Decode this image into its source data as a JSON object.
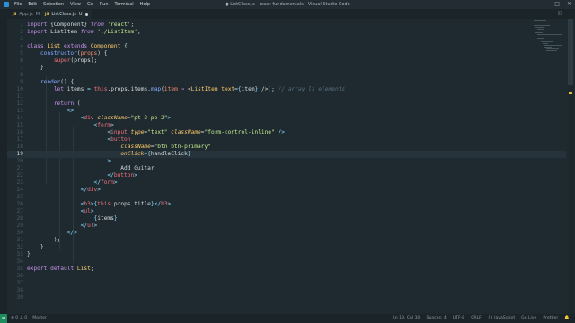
{
  "window": {
    "title": "● ListClass.js - react-fundamentals - Visual Studio Code",
    "menu": [
      "File",
      "Edit",
      "Selection",
      "View",
      "Go",
      "Run",
      "Terminal",
      "Help"
    ]
  },
  "tabs": [
    {
      "label": "App.js",
      "badge": "M",
      "active": false
    },
    {
      "label": "ListClass.js",
      "badge": "U",
      "active": true,
      "modified": true
    }
  ],
  "editor": {
    "current_line": 19,
    "lines": [
      {
        "n": "1"
      },
      {
        "n": "2"
      },
      {
        "n": "3"
      },
      {
        "n": "4"
      },
      {
        "n": "5"
      },
      {
        "n": "6"
      },
      {
        "n": "7"
      },
      {
        "n": "8"
      },
      {
        "n": "9"
      },
      {
        "n": "10"
      },
      {
        "n": "11"
      },
      {
        "n": "12"
      },
      {
        "n": "13"
      },
      {
        "n": "14"
      },
      {
        "n": "15"
      },
      {
        "n": "16"
      },
      {
        "n": "17"
      },
      {
        "n": "18"
      },
      {
        "n": "19"
      },
      {
        "n": "20"
      },
      {
        "n": "21"
      },
      {
        "n": "22"
      },
      {
        "n": "23"
      },
      {
        "n": "24"
      },
      {
        "n": "25"
      },
      {
        "n": "26"
      },
      {
        "n": "27"
      },
      {
        "n": "28"
      },
      {
        "n": "29"
      },
      {
        "n": "30"
      },
      {
        "n": "31"
      },
      {
        "n": "32"
      },
      {
        "n": "33"
      },
      {
        "n": "34"
      },
      {
        "n": "35"
      },
      {
        "n": "36"
      },
      {
        "n": "37"
      },
      {
        "n": "38"
      },
      {
        "n": "39"
      }
    ]
  },
  "statusbar": {
    "left": [
      "⊗ 0 ⚠ 0",
      "Master"
    ],
    "right": [
      "Ln 19, Col 30",
      "Spaces: 4",
      "UTF-8",
      "CRLF",
      "{} JavaScript",
      "Go Live",
      "Prettier"
    ]
  },
  "colors": {
    "background": "#1f2a30",
    "accent": "#1c8c5c",
    "keyword": "#c792ea",
    "string": "#c3e88d",
    "tag": "#f07178"
  }
}
